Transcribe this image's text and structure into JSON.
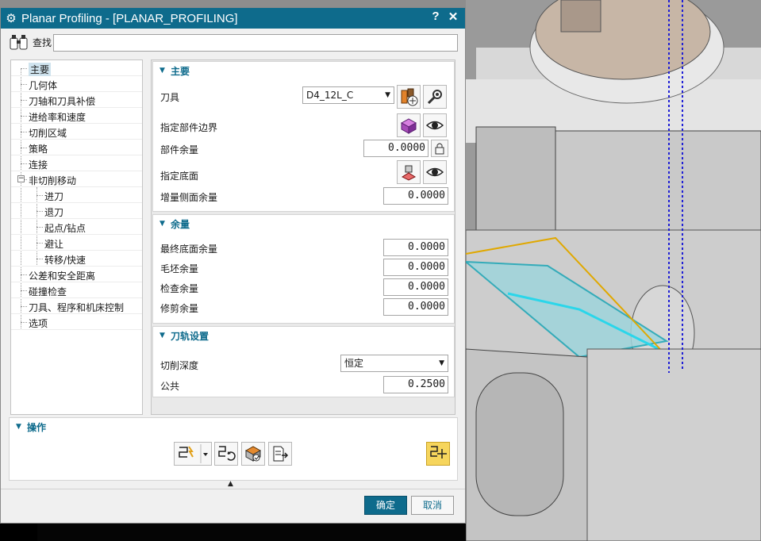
{
  "dialog": {
    "title": "Planar Profiling - [PLANAR_PROFILING]",
    "help_label": "?",
    "close_label": "✕"
  },
  "find": {
    "label": "查找",
    "value": ""
  },
  "nav": {
    "items": [
      {
        "label": "主要",
        "indent": 0,
        "selected": true
      },
      {
        "label": "几何体",
        "indent": 0
      },
      {
        "label": "刀轴和刀具补偿",
        "indent": 0
      },
      {
        "label": "进给率和速度",
        "indent": 0
      },
      {
        "label": "切削区域",
        "indent": 0
      },
      {
        "label": "策略",
        "indent": 0
      },
      {
        "label": "连接",
        "indent": 0
      },
      {
        "label": "非切削移动",
        "indent": 0,
        "toggle": "−"
      },
      {
        "label": "进刀",
        "indent": 1
      },
      {
        "label": "退刀",
        "indent": 1
      },
      {
        "label": "起点/钻点",
        "indent": 1
      },
      {
        "label": "避让",
        "indent": 1
      },
      {
        "label": "转移/快速",
        "indent": 1
      },
      {
        "label": "公差和安全距离",
        "indent": 0
      },
      {
        "label": "碰撞检查",
        "indent": 0
      },
      {
        "label": "刀具、程序和机床控制",
        "indent": 0
      },
      {
        "label": "选项",
        "indent": 0
      }
    ]
  },
  "main_section": {
    "title": "主要",
    "tool_label": "刀具",
    "tool_value": "D4_12L_C",
    "part_boundary_label": "指定部件边界",
    "part_stock_label": "部件余量",
    "part_stock_value": "0.0000",
    "floor_label": "指定底面",
    "side_stock_label": "增量侧面余量",
    "side_stock_value": "0.0000"
  },
  "stock_section": {
    "title": "余量",
    "rows": [
      {
        "label": "最终底面余量",
        "value": "0.0000"
      },
      {
        "label": "毛坯余量",
        "value": "0.0000"
      },
      {
        "label": "检查余量",
        "value": "0.0000"
      },
      {
        "label": "修剪余量",
        "value": "0.0000"
      }
    ]
  },
  "path_section": {
    "title": "刀轨设置",
    "depth_label": "切削深度",
    "depth_value": "恒定",
    "common_label": "公共",
    "common_value": "0.2500"
  },
  "ops_section": {
    "title": "操作"
  },
  "buttons": {
    "ok": "确定",
    "cancel": "取消"
  },
  "colors": {
    "accent": "#0e6b8c",
    "selected": "#cfe3ee",
    "highlight_btn": "#f6d55c"
  }
}
